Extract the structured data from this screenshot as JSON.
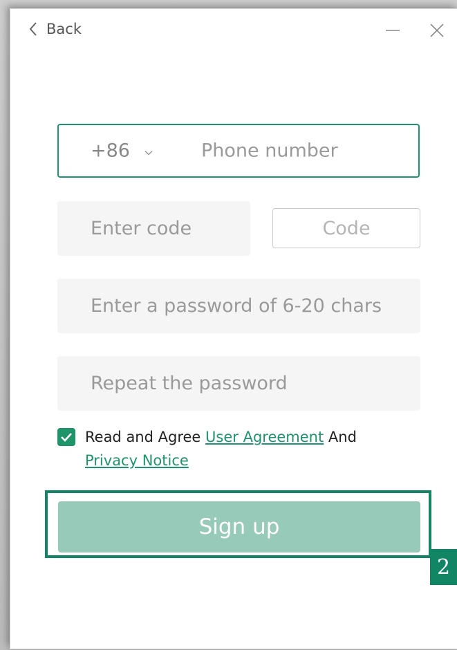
{
  "titlebar": {
    "back_label": "Back"
  },
  "form": {
    "country_code": "+86",
    "phone_placeholder": "Phone number",
    "code_placeholder": "Enter code",
    "code_button": "Code",
    "password_placeholder": "Enter a password of 6-20 chars",
    "repeat_password_placeholder": "Repeat the password"
  },
  "agreement": {
    "checked": true,
    "prefix": "Read and Agree",
    "user_agreement": "User Agreement",
    "conjunction": "And",
    "privacy_notice": "Privacy Notice"
  },
  "signup_button": "Sign up",
  "callout_badge": "2",
  "colors": {
    "accent": "#1d946a",
    "button_disabled": "#97cab8",
    "highlight_frame": "#128564",
    "field_bg": "#f5f5f5"
  },
  "icons": [
    "chevron-left-icon",
    "minimize-icon",
    "close-icon",
    "chevron-down-icon",
    "checkmark-icon"
  ]
}
